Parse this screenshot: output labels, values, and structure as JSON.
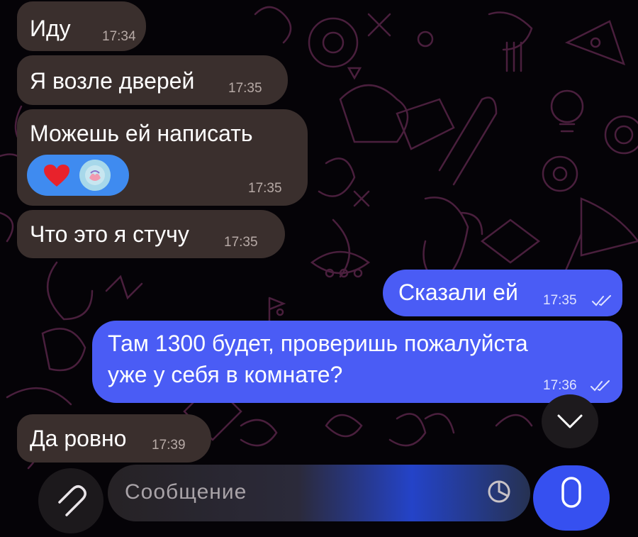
{
  "messages": [
    {
      "text": "Иду",
      "time": "17:34",
      "direction": "incoming"
    },
    {
      "text": "Я возле дверей",
      "time": "17:35",
      "direction": "incoming"
    },
    {
      "text": "Можешь ей написать",
      "time": "17:35",
      "direction": "incoming",
      "reactions": [
        "heart",
        "heart-hands-avatar"
      ]
    },
    {
      "text": "Что это я стучу",
      "time": "17:35",
      "direction": "incoming"
    },
    {
      "text": "Сказали ей",
      "time": "17:35",
      "direction": "outgoing",
      "read": true
    },
    {
      "lines": [
        "Там 1300 будет, проверишь пожалуйста",
        "уже у себя в комнате?"
      ],
      "time": "17:36",
      "direction": "outgoing",
      "read": true
    },
    {
      "text": "Да ровно",
      "time": "17:39",
      "direction": "incoming"
    }
  ],
  "composer": {
    "placeholder": "Сообщение"
  },
  "icons": {
    "attach": "paperclip-icon",
    "scroll": "chevron-down-icon",
    "mic": "microphone-icon",
    "sticker": "sticker-icon",
    "read": "double-check-icon"
  },
  "colors": {
    "background": "#050307",
    "incoming_bubble": "#3a2f2d",
    "outgoing_bubble": "#4a5cf5",
    "reaction_pill": "#3f8bf0",
    "wallpaper_doodles": "#4a1f3d"
  }
}
